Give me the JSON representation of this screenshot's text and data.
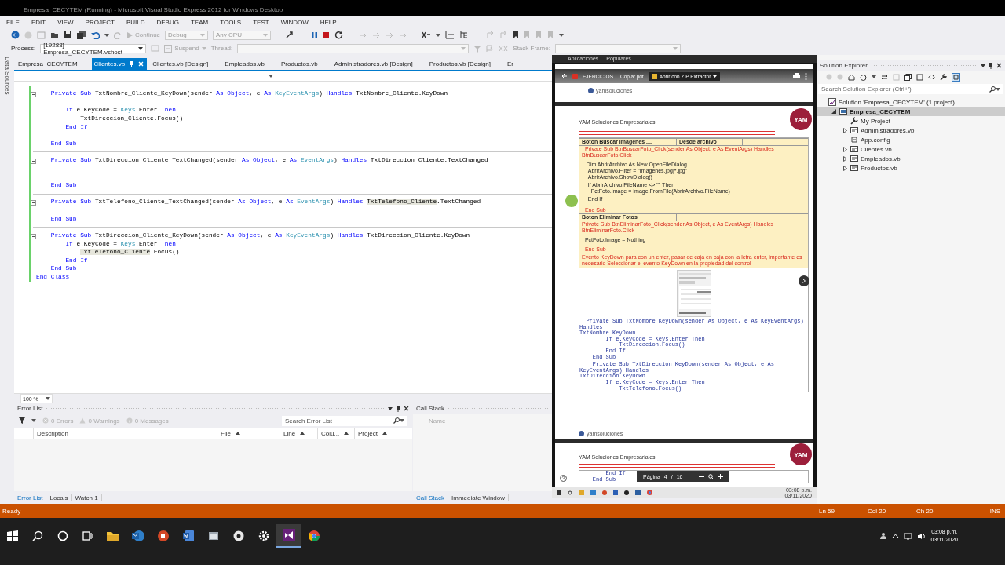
{
  "window": {
    "title": "Empresa_CECYTEM (Running) - Microsoft Visual Studio Express 2012 for Windows Desktop"
  },
  "menu": [
    "FILE",
    "EDIT",
    "VIEW",
    "PROJECT",
    "BUILD",
    "DEBUG",
    "TEAM",
    "TOOLS",
    "TEST",
    "WINDOW",
    "HELP"
  ],
  "toolbar": {
    "continue": "Continue",
    "configuration": "Debug",
    "platform": "Any CPU"
  },
  "debug_toolbar": {
    "process_label": "Process:",
    "process": "[19288] Empresa_CECYTEM.vshost",
    "suspend": "Suspend",
    "thread_label": "Thread:",
    "stack_frame_label": "Stack Frame:"
  },
  "side_tab": "Data Sources",
  "document_tabs": [
    {
      "label": "Empresa_CECYTEM",
      "selected": false
    },
    {
      "label": "Clientes.vb",
      "selected": true
    },
    {
      "label": "Clientes.vb [Design]",
      "selected": false
    },
    {
      "label": "Empleados.vb",
      "selected": false
    },
    {
      "label": "Productos.vb",
      "selected": false
    },
    {
      "label": "Administradores.vb [Design]",
      "selected": false
    },
    {
      "label": "Productos.vb [Design]",
      "selected": false
    },
    {
      "label": "Er",
      "selected": false
    }
  ],
  "code": {
    "lines": [
      {
        "kind": "sub-start",
        "segments": [
          {
            "text": "    Private Sub ",
            "kind": "keyword"
          },
          {
            "text": "TxtNombre_Cliente_KeyDown(sender ",
            "kind": "plain"
          },
          {
            "text": "As Object",
            "kind": "keyword"
          },
          {
            "text": ", e ",
            "kind": "plain"
          },
          {
            "text": "As ",
            "kind": "keyword"
          },
          {
            "text": "KeyEventArgs",
            "kind": "type"
          },
          {
            "text": ") ",
            "kind": "plain"
          },
          {
            "text": "Handles ",
            "kind": "keyword"
          },
          {
            "text": "TxtNombre_Cliente.KeyDown",
            "kind": "plain"
          }
        ]
      },
      {
        "kind": "blank"
      },
      {
        "kind": "code",
        "segments": [
          {
            "text": "        If ",
            "kind": "keyword"
          },
          {
            "text": "e.KeyCode = ",
            "kind": "plain"
          },
          {
            "text": "Keys",
            "kind": "type"
          },
          {
            "text": ".Enter ",
            "kind": "plain"
          },
          {
            "text": "Then",
            "kind": "keyword"
          }
        ]
      },
      {
        "kind": "code",
        "segments": [
          {
            "text": "            TxtDireccion_Cliente.Focus()",
            "kind": "plain"
          }
        ]
      },
      {
        "kind": "code",
        "segments": [
          {
            "text": "        End If",
            "kind": "keyword"
          }
        ]
      },
      {
        "kind": "blank"
      },
      {
        "kind": "code",
        "segments": [
          {
            "text": "    End Sub",
            "kind": "keyword"
          }
        ]
      },
      {
        "kind": "separator"
      },
      {
        "kind": "sub-start",
        "segments": [
          {
            "text": "    Private Sub ",
            "kind": "keyword"
          },
          {
            "text": "TxtDireccion_Cliente_TextChanged(sender ",
            "kind": "plain"
          },
          {
            "text": "As Object",
            "kind": "keyword"
          },
          {
            "text": ", e ",
            "kind": "plain"
          },
          {
            "text": "As ",
            "kind": "keyword"
          },
          {
            "text": "EventArgs",
            "kind": "type"
          },
          {
            "text": ") ",
            "kind": "plain"
          },
          {
            "text": "Handles ",
            "kind": "keyword"
          },
          {
            "text": "TxtDireccion_Cliente.TextChanged",
            "kind": "plain"
          }
        ]
      },
      {
        "kind": "blank"
      },
      {
        "kind": "blank"
      },
      {
        "kind": "code",
        "segments": [
          {
            "text": "    End Sub",
            "kind": "keyword"
          }
        ]
      },
      {
        "kind": "separator"
      },
      {
        "kind": "sub-start",
        "segments": [
          {
            "text": "    Private Sub ",
            "kind": "keyword"
          },
          {
            "text": "TxtTelefono_Cliente_TextChanged(sender ",
            "kind": "plain"
          },
          {
            "text": "As Object",
            "kind": "keyword"
          },
          {
            "text": ", e ",
            "kind": "plain"
          },
          {
            "text": "As ",
            "kind": "keyword"
          },
          {
            "text": "EventArgs",
            "kind": "type"
          },
          {
            "text": ") ",
            "kind": "plain"
          },
          {
            "text": "Handles ",
            "kind": "keyword"
          },
          {
            "text": "TxtTelefono_Cliente",
            "kind": "reference"
          },
          {
            "text": ".TextChanged",
            "kind": "plain"
          }
        ]
      },
      {
        "kind": "blank"
      },
      {
        "kind": "code",
        "segments": [
          {
            "text": "    End Sub",
            "kind": "keyword"
          }
        ]
      },
      {
        "kind": "separator"
      },
      {
        "kind": "sub-start",
        "segments": [
          {
            "text": "    Private Sub ",
            "kind": "keyword"
          },
          {
            "text": "TxtDireccion_Cliente_KeyDown(sender ",
            "kind": "plain"
          },
          {
            "text": "As Object",
            "kind": "keyword"
          },
          {
            "text": ", e ",
            "kind": "plain"
          },
          {
            "text": "As ",
            "kind": "keyword"
          },
          {
            "text": "KeyEventArgs",
            "kind": "type"
          },
          {
            "text": ") ",
            "kind": "plain"
          },
          {
            "text": "Handles ",
            "kind": "keyword"
          },
          {
            "text": "TxtDireccion_Cliente.KeyDown",
            "kind": "plain"
          }
        ]
      },
      {
        "kind": "code",
        "segments": [
          {
            "text": "        If ",
            "kind": "keyword"
          },
          {
            "text": "e.KeyCode = ",
            "kind": "plain"
          },
          {
            "text": "Keys",
            "kind": "type"
          },
          {
            "text": ".Enter ",
            "kind": "plain"
          },
          {
            "text": "Then",
            "kind": "keyword"
          }
        ]
      },
      {
        "kind": "code",
        "segments": [
          {
            "text": "            TxtTelefono_Cliente",
            "kind": "reference"
          },
          {
            "text": ".Focus()",
            "kind": "plain"
          }
        ]
      },
      {
        "kind": "code",
        "segments": [
          {
            "text": "        End If",
            "kind": "keyword"
          }
        ]
      },
      {
        "kind": "code",
        "segments": [
          {
            "text": "    End Sub",
            "kind": "keyword"
          }
        ]
      },
      {
        "kind": "code",
        "segments": [
          {
            "text": "End Class",
            "kind": "keyword"
          }
        ]
      }
    ]
  },
  "zoom": "100 %",
  "error_list": {
    "title": "Error List",
    "counts": [
      "0 Errors",
      "0 Warnings",
      "0 Messages"
    ],
    "search": {
      "placeholder": "Search Error List"
    },
    "columns": [
      {
        "label": "Description",
        "sort_arrow": false
      },
      {
        "label": "File",
        "sort_arrow": true
      },
      {
        "label": "Line",
        "sort_arrow": true
      },
      {
        "label": "Colu...",
        "sort_arrow": true
      },
      {
        "label": "Project",
        "sort_arrow": true
      }
    ],
    "panel_tabs": [
      {
        "label": "Error List",
        "selected": true
      },
      {
        "label": "Locals",
        "selected": false
      },
      {
        "label": "Watch 1",
        "selected": false
      }
    ]
  },
  "call_stack": {
    "title": "Call Stack",
    "columns": [
      "Name"
    ],
    "panel_tabs": [
      {
        "label": "Call Stack",
        "selected": true
      },
      {
        "label": "Immediate Window",
        "selected": false
      }
    ]
  },
  "solution_explorer": {
    "title": "Solution Explorer",
    "search": {
      "placeholder": "Search Solution Explorer (Ctrl+')"
    },
    "tree": [
      {
        "label": "Solution 'Empresa_CECYTEM' (1 project)",
        "kind": "solution",
        "selected": false,
        "children": [
          {
            "label": "Empresa_CECYTEM",
            "kind": "project",
            "selected": true,
            "expanded": true,
            "children": [
              {
                "label": "My Project",
                "kind": "properties",
                "selected": false
              },
              {
                "label": "Administradores.vb",
                "kind": "vbfile",
                "selected": false,
                "expanded": false
              },
              {
                "label": "App.config",
                "kind": "config",
                "selected": false
              },
              {
                "label": "Clientes.vb",
                "kind": "vbfile",
                "selected": false,
                "expanded": false
              },
              {
                "label": "Empleados.vb",
                "kind": "vbfile",
                "selected": false,
                "expanded": false
              },
              {
                "label": "Productos.vb",
                "kind": "vbfile",
                "selected": false,
                "expanded": false
              }
            ]
          }
        ]
      }
    ]
  },
  "pdf_viewer": {
    "bookmarks": [
      "Aplicaciones",
      "Populares"
    ],
    "file_name": "EJERCICIOS ... Copiar.pdf",
    "open_with": "Abrir con ZIP Extractor",
    "page_top_footer": "yamsoluciones",
    "page": {
      "company": "YAM Soluciones Empresariales",
      "logo": "YAM",
      "rows": [
        {
          "kind": "heading",
          "cells": [
            "Boton Buscar Imagenes ....",
            "Desde archivo"
          ]
        },
        {
          "kind": "red",
          "text": "  Private Sub BtnBuscarFoto_Click(sender As Object, e As EventArgs) Handles BtnBuscarFoto.Click"
        },
        {
          "kind": "blank"
        },
        {
          "kind": "blank"
        },
        {
          "kind": "black",
          "text": "   Dim AbrirArchivo As New OpenFileDialog"
        },
        {
          "kind": "black",
          "text": "    AbrirArchivo.Filter = \"Imagenes.jpg|*.jpg\""
        },
        {
          "kind": "black",
          "text": "    AbrirArchivo.ShowDialog()"
        },
        {
          "kind": "blank"
        },
        {
          "kind": "black",
          "text": "    If AbrirArchivo.FileName <> \"\" Then"
        },
        {
          "kind": "black",
          "text": "      PctFoto.Image = Image.FromFile(AbrirArchivo.FileName)"
        },
        {
          "kind": "blank"
        },
        {
          "kind": "black",
          "text": "    End If"
        },
        {
          "kind": "blank"
        },
        {
          "kind": "blank"
        },
        {
          "kind": "blank"
        },
        {
          "kind": "red",
          "text": "  End Sub"
        },
        {
          "kind": "heading",
          "cells": [
            "Boton Eliminar Fotos"
          ]
        },
        {
          "kind": "red",
          "text": "Private Sub BtnEliminarFoto_Click(sender As Object, e As EventArgs) Handles BtnEliminarFoto.Click"
        },
        {
          "kind": "blank"
        },
        {
          "kind": "blank"
        },
        {
          "kind": "black",
          "text": "  PctFoto.Image = Nothing"
        },
        {
          "kind": "blank"
        },
        {
          "kind": "blank"
        },
        {
          "kind": "red",
          "text": "  End Sub"
        },
        {
          "kind": "note",
          "text": "Evento KeyDown para con un enter, pasar de caja en caja con la letra enter, importante es necesario Seleccionar el evento KeyDown en la propiedad del control"
        },
        {
          "kind": "figure"
        },
        {
          "kind": "mono",
          "text": "  Private Sub TxtNombre_KeyDown(sender As Object, e As KeyEventArgs) Handles"
        },
        {
          "kind": "mono",
          "text": "TxtNombre.KeyDown"
        },
        {
          "kind": "mono",
          "text": "        If e.KeyCode = Keys.Enter Then"
        },
        {
          "kind": "mono",
          "text": "            TxtDireccion.Focus()"
        },
        {
          "kind": "mono",
          "text": "        End If"
        },
        {
          "kind": "mono",
          "text": "    End Sub"
        },
        {
          "kind": "blank"
        },
        {
          "kind": "mono",
          "text": "    Private Sub TxtDireccion_KeyDown(sender As Object, e As KeyEventArgs) Handles"
        },
        {
          "kind": "mono",
          "text": "TxtDireccion.KeyDown"
        },
        {
          "kind": "mono",
          "text": "        If e.KeyCode = Keys.Enter Then"
        },
        {
          "kind": "mono",
          "text": "            TxtTelefono.Focus()"
        }
      ],
      "footer": "yamsoluciones"
    },
    "next_page": {
      "company": "YAM Soluciones Empresariales",
      "logo": "YAM",
      "lines": [
        "        End If",
        "    End Sub"
      ]
    },
    "page_toolbar": {
      "label": "Página",
      "page": "4",
      "separator": "/",
      "total": "16"
    },
    "taskbar": {
      "time": "03:08 p.m.",
      "date": "03/11/2020"
    }
  },
  "status_bar": {
    "text": "Ready",
    "line": "Ln 59",
    "column": "Col 20",
    "char": "Ch 20",
    "mode": "INS"
  },
  "taskbar": {
    "apps": [
      {
        "kind": "start",
        "active": false
      },
      {
        "kind": "search",
        "active": false
      },
      {
        "kind": "cortana",
        "active": false
      },
      {
        "kind": "task-view",
        "active": false
      },
      {
        "kind": "folder",
        "active": false
      },
      {
        "kind": "mail",
        "active": false
      },
      {
        "kind": "slides",
        "active": false
      },
      {
        "kind": "document",
        "active": false
      },
      {
        "kind": "app",
        "active": false
      },
      {
        "kind": "disc",
        "active": false
      },
      {
        "kind": "settings",
        "active": false
      },
      {
        "kind": "ide",
        "active": true
      },
      {
        "kind": "browser",
        "active": false
      }
    ],
    "time": "03:08 p.m.",
    "date": "03/11/2020"
  }
}
